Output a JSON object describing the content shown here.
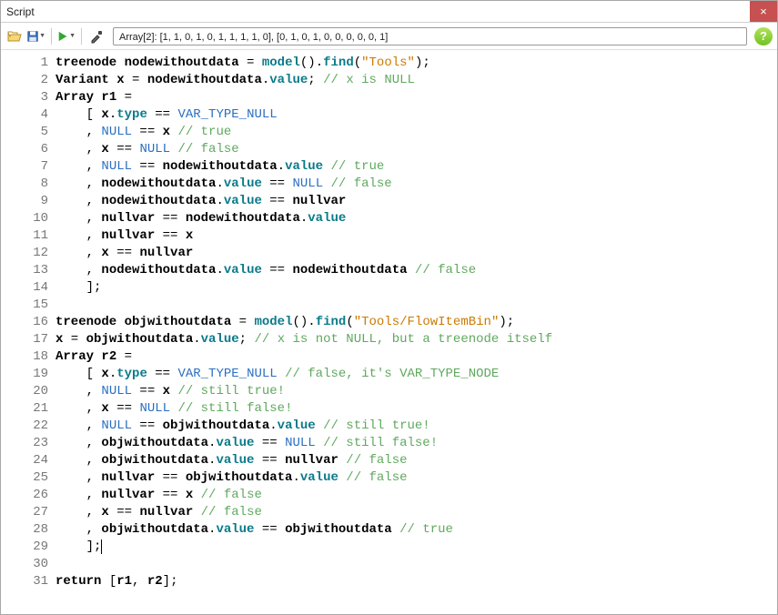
{
  "window": {
    "title": "Script",
    "close_label": "×"
  },
  "toolbar": {
    "result_text": "Array[2]: [1, 1, 0, 1, 0, 1, 1, 1, 1, 0], [0, 1, 0, 1, 0, 0, 0, 0, 0, 1]",
    "help_label": "?"
  },
  "code": {
    "lines": [
      {
        "n": 1,
        "tokens": [
          {
            "c": "keyword",
            "t": "treenode"
          },
          {
            "c": "plain",
            "t": " "
          },
          {
            "c": "ident",
            "t": "nodewithoutdata"
          },
          {
            "c": "plain",
            "t": " = "
          },
          {
            "c": "method",
            "t": "model"
          },
          {
            "c": "punct",
            "t": "()."
          },
          {
            "c": "method",
            "t": "find"
          },
          {
            "c": "punct",
            "t": "("
          },
          {
            "c": "string",
            "t": "\"Tools\""
          },
          {
            "c": "punct",
            "t": ");"
          }
        ]
      },
      {
        "n": 2,
        "tokens": [
          {
            "c": "keyword",
            "t": "Variant"
          },
          {
            "c": "plain",
            "t": " "
          },
          {
            "c": "ident",
            "t": "x"
          },
          {
            "c": "plain",
            "t": " = "
          },
          {
            "c": "ident",
            "t": "nodewithoutdata"
          },
          {
            "c": "punct",
            "t": "."
          },
          {
            "c": "prop",
            "t": "value"
          },
          {
            "c": "punct",
            "t": "; "
          },
          {
            "c": "comment",
            "t": "// x is NULL"
          }
        ]
      },
      {
        "n": 3,
        "tokens": [
          {
            "c": "keyword",
            "t": "Array"
          },
          {
            "c": "plain",
            "t": " "
          },
          {
            "c": "ident",
            "t": "r1"
          },
          {
            "c": "plain",
            "t": " ="
          }
        ]
      },
      {
        "n": 4,
        "tokens": [
          {
            "c": "plain",
            "t": "    [ "
          },
          {
            "c": "ident",
            "t": "x"
          },
          {
            "c": "punct",
            "t": "."
          },
          {
            "c": "prop",
            "t": "type"
          },
          {
            "c": "plain",
            "t": " == "
          },
          {
            "c": "const",
            "t": "VAR_TYPE_NULL"
          }
        ]
      },
      {
        "n": 5,
        "tokens": [
          {
            "c": "plain",
            "t": "    , "
          },
          {
            "c": "const",
            "t": "NULL"
          },
          {
            "c": "plain",
            "t": " == "
          },
          {
            "c": "ident",
            "t": "x"
          },
          {
            "c": "plain",
            "t": " "
          },
          {
            "c": "comment",
            "t": "// true"
          }
        ]
      },
      {
        "n": 6,
        "tokens": [
          {
            "c": "plain",
            "t": "    , "
          },
          {
            "c": "ident",
            "t": "x"
          },
          {
            "c": "plain",
            "t": " == "
          },
          {
            "c": "const",
            "t": "NULL"
          },
          {
            "c": "plain",
            "t": " "
          },
          {
            "c": "comment",
            "t": "// false"
          }
        ]
      },
      {
        "n": 7,
        "tokens": [
          {
            "c": "plain",
            "t": "    , "
          },
          {
            "c": "const",
            "t": "NULL"
          },
          {
            "c": "plain",
            "t": " == "
          },
          {
            "c": "ident",
            "t": "nodewithoutdata"
          },
          {
            "c": "punct",
            "t": "."
          },
          {
            "c": "prop",
            "t": "value"
          },
          {
            "c": "plain",
            "t": " "
          },
          {
            "c": "comment",
            "t": "// true"
          }
        ]
      },
      {
        "n": 8,
        "tokens": [
          {
            "c": "plain",
            "t": "    , "
          },
          {
            "c": "ident",
            "t": "nodewithoutdata"
          },
          {
            "c": "punct",
            "t": "."
          },
          {
            "c": "prop",
            "t": "value"
          },
          {
            "c": "plain",
            "t": " == "
          },
          {
            "c": "const",
            "t": "NULL"
          },
          {
            "c": "plain",
            "t": " "
          },
          {
            "c": "comment",
            "t": "// false"
          }
        ]
      },
      {
        "n": 9,
        "tokens": [
          {
            "c": "plain",
            "t": "    , "
          },
          {
            "c": "ident",
            "t": "nodewithoutdata"
          },
          {
            "c": "punct",
            "t": "."
          },
          {
            "c": "prop",
            "t": "value"
          },
          {
            "c": "plain",
            "t": " == "
          },
          {
            "c": "ident",
            "t": "nullvar"
          }
        ]
      },
      {
        "n": 10,
        "tokens": [
          {
            "c": "plain",
            "t": "    , "
          },
          {
            "c": "ident",
            "t": "nullvar"
          },
          {
            "c": "plain",
            "t": " == "
          },
          {
            "c": "ident",
            "t": "nodewithoutdata"
          },
          {
            "c": "punct",
            "t": "."
          },
          {
            "c": "prop",
            "t": "value"
          }
        ]
      },
      {
        "n": 11,
        "tokens": [
          {
            "c": "plain",
            "t": "    , "
          },
          {
            "c": "ident",
            "t": "nullvar"
          },
          {
            "c": "plain",
            "t": " == "
          },
          {
            "c": "ident",
            "t": "x"
          }
        ]
      },
      {
        "n": 12,
        "tokens": [
          {
            "c": "plain",
            "t": "    , "
          },
          {
            "c": "ident",
            "t": "x"
          },
          {
            "c": "plain",
            "t": " == "
          },
          {
            "c": "ident",
            "t": "nullvar"
          }
        ]
      },
      {
        "n": 13,
        "tokens": [
          {
            "c": "plain",
            "t": "    , "
          },
          {
            "c": "ident",
            "t": "nodewithoutdata"
          },
          {
            "c": "punct",
            "t": "."
          },
          {
            "c": "prop",
            "t": "value"
          },
          {
            "c": "plain",
            "t": " == "
          },
          {
            "c": "ident",
            "t": "nodewithoutdata"
          },
          {
            "c": "plain",
            "t": " "
          },
          {
            "c": "comment",
            "t": "// false"
          }
        ]
      },
      {
        "n": 14,
        "tokens": [
          {
            "c": "plain",
            "t": "    ];"
          }
        ]
      },
      {
        "n": 15,
        "tokens": []
      },
      {
        "n": 16,
        "tokens": [
          {
            "c": "keyword",
            "t": "treenode"
          },
          {
            "c": "plain",
            "t": " "
          },
          {
            "c": "ident",
            "t": "objwithoutdata"
          },
          {
            "c": "plain",
            "t": " = "
          },
          {
            "c": "method",
            "t": "model"
          },
          {
            "c": "punct",
            "t": "()."
          },
          {
            "c": "method",
            "t": "find"
          },
          {
            "c": "punct",
            "t": "("
          },
          {
            "c": "string",
            "t": "\"Tools/FlowItemBin\""
          },
          {
            "c": "punct",
            "t": ");"
          }
        ]
      },
      {
        "n": 17,
        "tokens": [
          {
            "c": "ident",
            "t": "x"
          },
          {
            "c": "plain",
            "t": " = "
          },
          {
            "c": "ident",
            "t": "objwithoutdata"
          },
          {
            "c": "punct",
            "t": "."
          },
          {
            "c": "prop",
            "t": "value"
          },
          {
            "c": "punct",
            "t": "; "
          },
          {
            "c": "comment",
            "t": "// x is not NULL, but a treenode itself"
          }
        ]
      },
      {
        "n": 18,
        "tokens": [
          {
            "c": "keyword",
            "t": "Array"
          },
          {
            "c": "plain",
            "t": " "
          },
          {
            "c": "ident",
            "t": "r2"
          },
          {
            "c": "plain",
            "t": " ="
          }
        ]
      },
      {
        "n": 19,
        "tokens": [
          {
            "c": "plain",
            "t": "    [ "
          },
          {
            "c": "ident",
            "t": "x"
          },
          {
            "c": "punct",
            "t": "."
          },
          {
            "c": "prop",
            "t": "type"
          },
          {
            "c": "plain",
            "t": " == "
          },
          {
            "c": "const",
            "t": "VAR_TYPE_NULL"
          },
          {
            "c": "plain",
            "t": " "
          },
          {
            "c": "comment",
            "t": "// false, it's VAR_TYPE_NODE"
          }
        ]
      },
      {
        "n": 20,
        "tokens": [
          {
            "c": "plain",
            "t": "    , "
          },
          {
            "c": "const",
            "t": "NULL"
          },
          {
            "c": "plain",
            "t": " == "
          },
          {
            "c": "ident",
            "t": "x"
          },
          {
            "c": "plain",
            "t": " "
          },
          {
            "c": "comment",
            "t": "// still true!"
          }
        ]
      },
      {
        "n": 21,
        "tokens": [
          {
            "c": "plain",
            "t": "    , "
          },
          {
            "c": "ident",
            "t": "x"
          },
          {
            "c": "plain",
            "t": " == "
          },
          {
            "c": "const",
            "t": "NULL"
          },
          {
            "c": "plain",
            "t": " "
          },
          {
            "c": "comment",
            "t": "// still false!"
          }
        ]
      },
      {
        "n": 22,
        "tokens": [
          {
            "c": "plain",
            "t": "    , "
          },
          {
            "c": "const",
            "t": "NULL"
          },
          {
            "c": "plain",
            "t": " == "
          },
          {
            "c": "ident",
            "t": "objwithoutdata"
          },
          {
            "c": "punct",
            "t": "."
          },
          {
            "c": "prop",
            "t": "value"
          },
          {
            "c": "plain",
            "t": " "
          },
          {
            "c": "comment",
            "t": "// still true!"
          }
        ]
      },
      {
        "n": 23,
        "tokens": [
          {
            "c": "plain",
            "t": "    , "
          },
          {
            "c": "ident",
            "t": "objwithoutdata"
          },
          {
            "c": "punct",
            "t": "."
          },
          {
            "c": "prop",
            "t": "value"
          },
          {
            "c": "plain",
            "t": " == "
          },
          {
            "c": "const",
            "t": "NULL"
          },
          {
            "c": "plain",
            "t": " "
          },
          {
            "c": "comment",
            "t": "// still false!"
          }
        ]
      },
      {
        "n": 24,
        "tokens": [
          {
            "c": "plain",
            "t": "    , "
          },
          {
            "c": "ident",
            "t": "objwithoutdata"
          },
          {
            "c": "punct",
            "t": "."
          },
          {
            "c": "prop",
            "t": "value"
          },
          {
            "c": "plain",
            "t": " == "
          },
          {
            "c": "ident",
            "t": "nullvar"
          },
          {
            "c": "plain",
            "t": " "
          },
          {
            "c": "comment",
            "t": "// false"
          }
        ]
      },
      {
        "n": 25,
        "tokens": [
          {
            "c": "plain",
            "t": "    , "
          },
          {
            "c": "ident",
            "t": "nullvar"
          },
          {
            "c": "plain",
            "t": " == "
          },
          {
            "c": "ident",
            "t": "objwithoutdata"
          },
          {
            "c": "punct",
            "t": "."
          },
          {
            "c": "prop",
            "t": "value"
          },
          {
            "c": "plain",
            "t": " "
          },
          {
            "c": "comment",
            "t": "// false"
          }
        ]
      },
      {
        "n": 26,
        "tokens": [
          {
            "c": "plain",
            "t": "    , "
          },
          {
            "c": "ident",
            "t": "nullvar"
          },
          {
            "c": "plain",
            "t": " == "
          },
          {
            "c": "ident",
            "t": "x"
          },
          {
            "c": "plain",
            "t": " "
          },
          {
            "c": "comment",
            "t": "// false"
          }
        ]
      },
      {
        "n": 27,
        "tokens": [
          {
            "c": "plain",
            "t": "    , "
          },
          {
            "c": "ident",
            "t": "x"
          },
          {
            "c": "plain",
            "t": " == "
          },
          {
            "c": "ident",
            "t": "nullvar"
          },
          {
            "c": "plain",
            "t": " "
          },
          {
            "c": "comment",
            "t": "// false"
          }
        ]
      },
      {
        "n": 28,
        "tokens": [
          {
            "c": "plain",
            "t": "    , "
          },
          {
            "c": "ident",
            "t": "objwithoutdata"
          },
          {
            "c": "punct",
            "t": "."
          },
          {
            "c": "prop",
            "t": "value"
          },
          {
            "c": "plain",
            "t": " == "
          },
          {
            "c": "ident",
            "t": "objwithoutdata"
          },
          {
            "c": "plain",
            "t": " "
          },
          {
            "c": "comment",
            "t": "// true"
          }
        ]
      },
      {
        "n": 29,
        "tokens": [
          {
            "c": "plain",
            "t": "    ];"
          }
        ],
        "cursor_after": true
      },
      {
        "n": 30,
        "tokens": []
      },
      {
        "n": 31,
        "tokens": [
          {
            "c": "keyword",
            "t": "return"
          },
          {
            "c": "plain",
            "t": " ["
          },
          {
            "c": "ident",
            "t": "r1"
          },
          {
            "c": "plain",
            "t": ", "
          },
          {
            "c": "ident",
            "t": "r2"
          },
          {
            "c": "plain",
            "t": "];"
          }
        ]
      }
    ]
  }
}
